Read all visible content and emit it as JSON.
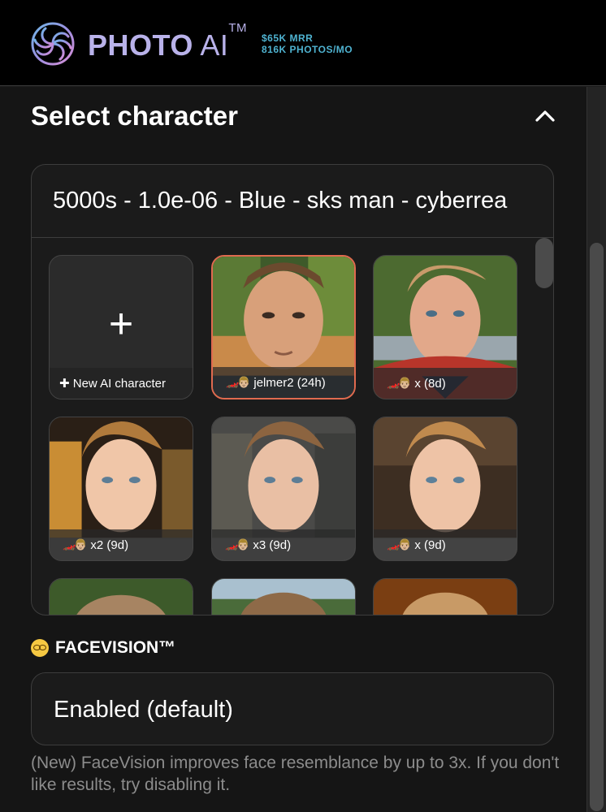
{
  "header": {
    "brand_bold": "PHOTO",
    "brand_light": "AI",
    "brand_tm": "TM",
    "stat_mrr": "$65K MRR",
    "stat_photos": "816K PHOTOS/MO",
    "logo_icon": "swirl-logo-icon"
  },
  "section": {
    "title": "Select character",
    "collapse_icon": "chevron-up-icon"
  },
  "character_select": {
    "value": "5000s - 1.0e-06 - Blue - sks man - cyberrea"
  },
  "tiles": {
    "new_label": "✚ New AI character",
    "plus": "+",
    "items": [
      {
        "emoji": "🏎️👨🏼",
        "label": "jelmer2 (24h)"
      },
      {
        "emoji": "🏎️👨🏼",
        "label": "x (8d)"
      },
      {
        "emoji": "🏎️👨🏼",
        "label": "x2 (9d)"
      },
      {
        "emoji": "🏎️👨🏼",
        "label": "x3 (9d)"
      },
      {
        "emoji": "🏎️👨🏼",
        "label": "x (9d)"
      }
    ]
  },
  "facevision": {
    "label": "FACEVISION™",
    "value": "Enabled (default)",
    "help": "(New) FaceVision improves face resemblance by up to 3x. If you don't like results, try disabling it."
  },
  "colors": {
    "accent_selected": "#e06a4f",
    "brand": "#b9b2ea",
    "stats": "#4fb3d1"
  }
}
